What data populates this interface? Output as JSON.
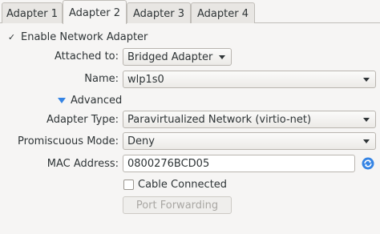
{
  "tabs": [
    {
      "label": "Adapter 1",
      "active": false
    },
    {
      "label": "Adapter 2",
      "active": true
    },
    {
      "label": "Adapter 3",
      "active": false
    },
    {
      "label": "Adapter 4",
      "active": false
    }
  ],
  "enable_adapter": {
    "label": "Enable Network Adapter",
    "checked": true,
    "mark": "✓"
  },
  "attached_to": {
    "label": "Attached to:",
    "value": "Bridged Adapter"
  },
  "name": {
    "label": "Name:",
    "value": "wlp1s0"
  },
  "advanced": {
    "label": "Advanced"
  },
  "adapter_type": {
    "label": "Adapter Type:",
    "value": "Paravirtualized Network (virtio-net)"
  },
  "promiscuous_mode": {
    "label": "Promiscuous Mode:",
    "value": "Deny"
  },
  "mac_address": {
    "label": "MAC Address:",
    "value": "0800276BCD05"
  },
  "cable_connected": {
    "label": "Cable Connected",
    "checked": false
  },
  "port_forwarding": {
    "label": "Port Forwarding",
    "enabled": false
  },
  "colors": {
    "accent": "#3584e4",
    "text": "#2e3436",
    "background": "#f6f5f4"
  },
  "icons": {
    "refresh": "refresh-icon",
    "expander": "expander-triangle-icon"
  }
}
